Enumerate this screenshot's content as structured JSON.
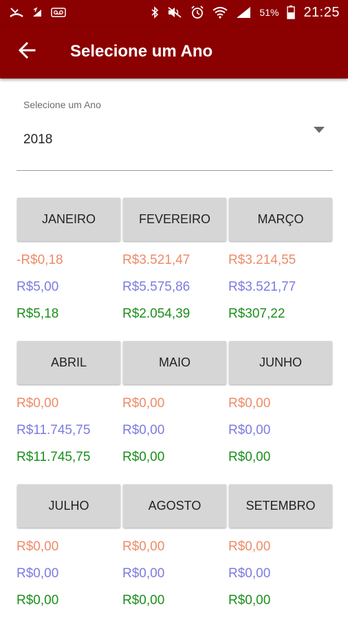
{
  "status_bar": {
    "battery_percent": "51%",
    "time": "21:25",
    "icons": [
      "missed-call-icon",
      "signal-boost-icon",
      "voicemail-icon",
      "bluetooth-icon",
      "mute-icon",
      "alarm-icon",
      "wifi-icon",
      "cell-signal-icon",
      "battery-icon"
    ]
  },
  "app_bar": {
    "title": "Selecione um Ano",
    "back_icon": "arrow-back-icon"
  },
  "year_select": {
    "label": "Selecione um Ano",
    "value": "2018",
    "arrow_icon": "dropdown-arrow-icon"
  },
  "colors": {
    "header": "#8b0000",
    "value_1": "#ee8a68",
    "value_2": "#7b7be0",
    "value_3": "#1a8f1a"
  },
  "months": [
    {
      "name": "JANEIRO",
      "v1": "-R$0,18",
      "v2": "R$5,00",
      "v3": "R$5,18"
    },
    {
      "name": "FEVEREIRO",
      "v1": "R$3.521,47",
      "v2": "R$5.575,86",
      "v3": "R$2.054,39"
    },
    {
      "name": "MARÇO",
      "v1": "R$3.214,55",
      "v2": "R$3.521,77",
      "v3": "R$307,22"
    },
    {
      "name": "ABRIL",
      "v1": "R$0,00",
      "v2": "R$11.745,75",
      "v3": "R$11.745,75"
    },
    {
      "name": "MAIO",
      "v1": "R$0,00",
      "v2": "R$0,00",
      "v3": "R$0,00"
    },
    {
      "name": "JUNHO",
      "v1": "R$0,00",
      "v2": "R$0,00",
      "v3": "R$0,00"
    },
    {
      "name": "JULHO",
      "v1": "R$0,00",
      "v2": "R$0,00",
      "v3": "R$0,00"
    },
    {
      "name": "AGOSTO",
      "v1": "R$0,00",
      "v2": "R$0,00",
      "v3": "R$0,00"
    },
    {
      "name": "SETEMBRO",
      "v1": "R$0,00",
      "v2": "R$0,00",
      "v3": "R$0,00"
    }
  ]
}
